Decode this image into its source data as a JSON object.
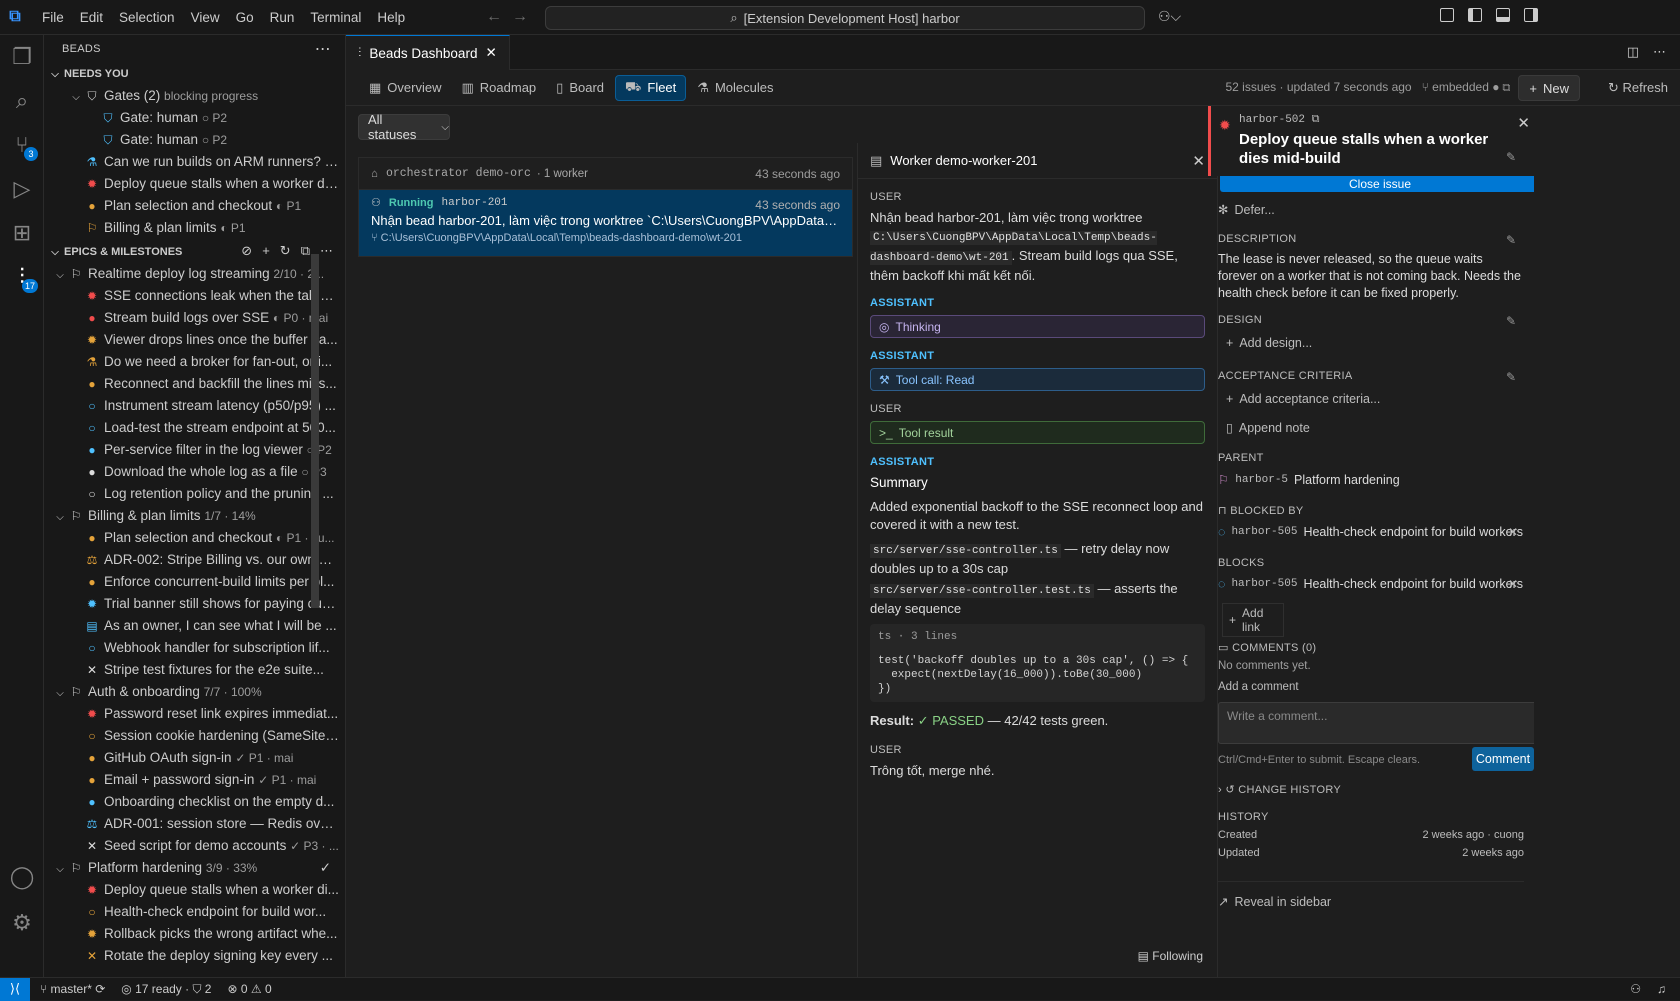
{
  "titlebar": {
    "menu": [
      "File",
      "Edit",
      "Selection",
      "View",
      "Go",
      "Run",
      "Terminal",
      "Help"
    ],
    "command_center": "[Extension Development Host] harbor"
  },
  "activity": {
    "scm_badge": "3",
    "beads_badge": "17"
  },
  "sidebar": {
    "title": "BEADS",
    "needs_you": {
      "label": "NEEDS YOU",
      "items": [
        {
          "text": "Gates (2)",
          "meta": "blocking progress",
          "indent": 1,
          "icon": "⛉",
          "tw": "⌵",
          "color": "#cccccc"
        },
        {
          "text": "Gate: human",
          "meta": "○ P2",
          "indent": 2,
          "icon": "⛉",
          "color": "#4fc1ff"
        },
        {
          "text": "Gate: human",
          "meta": "○ P2",
          "indent": 2,
          "icon": "⛉",
          "color": "#4fc1ff"
        },
        {
          "text": "Can we run builds on ARM runners?",
          "meta": "○...",
          "indent": 1,
          "icon": "⚗",
          "color": "#4fc1ff"
        },
        {
          "text": "Deploy queue stalls when a worker die...",
          "meta": "",
          "indent": 1,
          "icon": "✹",
          "color": "#f14c4c"
        },
        {
          "text": "Plan selection and checkout",
          "meta": "◐ P1",
          "indent": 1,
          "icon": "●",
          "color": "#e5a33a"
        },
        {
          "text": "Billing & plan limits",
          "meta": "◐ P1",
          "indent": 1,
          "icon": "⚐",
          "color": "#e5a33a"
        }
      ]
    },
    "epics": {
      "label": "EPICS & MILESTONES",
      "items": [
        {
          "text": "Realtime deploy log streaming",
          "meta": "2/10 · 2...",
          "indent": 0,
          "icon": "⚐",
          "tw": "⌵",
          "color": "#cccccc"
        },
        {
          "text": "SSE connections leak when the tab cl...",
          "meta": "",
          "indent": 1,
          "icon": "✹",
          "color": "#f14c4c"
        },
        {
          "text": "Stream build logs over SSE",
          "meta": "◐ P0 · mai",
          "indent": 1,
          "icon": "●",
          "color": "#f14c4c"
        },
        {
          "text": "Viewer drops lines once the buffer pa...",
          "meta": "",
          "indent": 1,
          "icon": "✹",
          "color": "#e5a33a"
        },
        {
          "text": "Do we need a broker for fan-out, or i...",
          "meta": "",
          "indent": 1,
          "icon": "⚗",
          "color": "#e5a33a"
        },
        {
          "text": "Reconnect and backfill the lines miss...",
          "meta": "",
          "indent": 1,
          "icon": "●",
          "color": "#e5a33a"
        },
        {
          "text": "Instrument stream latency (p50/p95) ...",
          "meta": "",
          "indent": 1,
          "icon": "○",
          "color": "#4fc1ff"
        },
        {
          "text": "Load-test the stream endpoint at 500...",
          "meta": "",
          "indent": 1,
          "icon": "○",
          "color": "#4fc1ff"
        },
        {
          "text": "Per-service filter in the log viewer",
          "meta": "○ P2",
          "indent": 1,
          "icon": "●",
          "color": "#4fc1ff"
        },
        {
          "text": "Download the whole log as a file",
          "meta": "○ P3",
          "indent": 1,
          "icon": "●",
          "color": "#dcdcdc"
        },
        {
          "text": "Log retention policy and the pruning ...",
          "meta": "",
          "indent": 1,
          "icon": "○",
          "color": "#dcdcdc"
        },
        {
          "text": "Billing & plan limits",
          "meta": "1/7 · 14%",
          "indent": 0,
          "icon": "⚐",
          "tw": "⌵",
          "color": "#cccccc"
        },
        {
          "text": "Plan selection and checkout",
          "meta": "◐ P1 · cu...",
          "indent": 1,
          "icon": "●",
          "color": "#e5a33a"
        },
        {
          "text": "ADR-002: Stripe Billing vs. our own m...",
          "meta": "",
          "indent": 1,
          "icon": "⚖",
          "color": "#e5a33a"
        },
        {
          "text": "Enforce concurrent-build limits per pl...",
          "meta": "",
          "indent": 1,
          "icon": "●",
          "color": "#e5a33a"
        },
        {
          "text": "Trial banner still shows for paying cus...",
          "meta": "",
          "indent": 1,
          "icon": "✹",
          "color": "#4fc1ff"
        },
        {
          "text": "As an owner, I can see what I will be ...",
          "meta": "",
          "indent": 1,
          "icon": "▤",
          "color": "#4fc1ff"
        },
        {
          "text": "Webhook handler for subscription lif...",
          "meta": "",
          "indent": 1,
          "icon": "○",
          "color": "#4fc1ff"
        },
        {
          "text": "Stripe test fixtures for the e2e suite...",
          "meta": "",
          "indent": 1,
          "icon": "✕",
          "color": "#dcdcdc"
        },
        {
          "text": "Auth & onboarding",
          "meta": "7/7 · 100%",
          "indent": 0,
          "icon": "⚐",
          "tw": "⌵",
          "color": "#cccccc"
        },
        {
          "text": "Password reset link expires immediat...",
          "meta": "",
          "indent": 1,
          "icon": "✹",
          "color": "#f14c4c"
        },
        {
          "text": "Session cookie hardening (SameSite, ...",
          "meta": "",
          "indent": 1,
          "icon": "○",
          "color": "#e5a33a"
        },
        {
          "text": "GitHub OAuth sign-in",
          "meta": "✓ P1 · mai",
          "indent": 1,
          "icon": "●",
          "color": "#e5a33a"
        },
        {
          "text": "Email + password sign-in",
          "meta": "✓ P1 · mai",
          "indent": 1,
          "icon": "●",
          "color": "#e5a33a"
        },
        {
          "text": "Onboarding checklist on the empty d...",
          "meta": "",
          "indent": 1,
          "icon": "●",
          "color": "#4fc1ff"
        },
        {
          "text": "ADR-001: session store — Redis over...",
          "meta": "",
          "indent": 1,
          "icon": "⚖",
          "color": "#4fc1ff"
        },
        {
          "text": "Seed script for demo accounts",
          "meta": "✓ P3 · ...",
          "indent": 1,
          "icon": "✕",
          "color": "#dcdcdc"
        },
        {
          "text": "Platform hardening",
          "meta": "3/9 · 33%",
          "indent": 0,
          "icon": "⚐",
          "tw": "⌵",
          "color": "#cccccc",
          "check": "✓"
        },
        {
          "text": "Deploy queue stalls when a worker di...",
          "meta": "",
          "indent": 1,
          "icon": "✹",
          "color": "#f14c4c"
        },
        {
          "text": "Health-check endpoint for build wor...",
          "meta": "",
          "indent": 1,
          "icon": "○",
          "color": "#e5a33a"
        },
        {
          "text": "Rollback picks the wrong artifact whe...",
          "meta": "",
          "indent": 1,
          "icon": "✹",
          "color": "#e5a33a"
        },
        {
          "text": "Rotate the deploy signing key every ...",
          "meta": "",
          "indent": 1,
          "icon": "✕",
          "color": "#e5a33a"
        }
      ]
    }
  },
  "editor": {
    "tab": "Beads Dashboard",
    "views": [
      {
        "label": "Overview",
        "icon": "▦"
      },
      {
        "label": "Roadmap",
        "icon": "▥"
      },
      {
        "label": "Board",
        "icon": "▯"
      },
      {
        "label": "Fleet",
        "icon": "⛟",
        "active": true
      },
      {
        "label": "Molecules",
        "icon": "⚗"
      }
    ],
    "status_text": "52 issues · updated 7 seconds ago",
    "mode": "embedded",
    "new_label": "New",
    "refresh_label": "Refresh",
    "filter": "All statuses",
    "fleet": {
      "orch": "orchestrator demo-orc",
      "orch_meta": "· 1 worker",
      "orch_time": "43 seconds ago",
      "worker_status": "Running",
      "worker_id": "harbor-201",
      "worker_time": "43 seconds ago",
      "worker_text": "Nhận bead harbor-201, làm việc trong worktree `C:\\Users\\CuongBPV\\AppData\\Local\\Temp\\beads-dashboard-demo\\wt-201`",
      "worker_path": "C:\\Users\\CuongBPV\\AppData\\Local\\Temp\\beads-dashboard-demo\\wt-201"
    },
    "worker": {
      "title": "Worker demo-worker-201",
      "user_label": "USER",
      "asst_label": "ASSISTANT",
      "msg1a": "Nhận bead harbor-201, làm việc trong worktree",
      "msg1code": "C:\\Users\\CuongBPV\\AppData\\Local\\Temp\\beads-dashboard-demo\\wt-201",
      "msg1b": ". Stream build logs qua SSE, thêm backoff khi mất kết nối.",
      "thinking": "Thinking",
      "toolcall": "Tool call: Read",
      "toolresult": "Tool result",
      "summary_title": "Summary",
      "summary_text": "Added exponential backoff to the SSE reconnect loop and covered it with a new test.",
      "file1": "src/server/sse-controller.ts",
      "file1_desc": "— retry delay now doubles up to a 30s cap",
      "file2": "src/server/sse-controller.test.ts",
      "file2_desc": "— asserts the delay sequence",
      "code_lang": "ts · 3 lines",
      "code_lines": [
        "test('backoff doubles up to a 30s cap', () => {",
        "  expect(nextDelay(16_000)).toBe(30_000)",
        "})"
      ],
      "result_label": "Result:",
      "result_status": "✓ PASSED",
      "result_text": "— 42/42 tests green.",
      "final_msg": "Trông tốt, merge nhé.",
      "following": "Following"
    },
    "detail": {
      "id": "harbor-502",
      "title": "Deploy queue stalls when a worker dies mid-build",
      "close_issue": "Close issue",
      "defer": "Defer...",
      "description_label": "DESCRIPTION",
      "description": "The lease is never released, so the queue waits forever on a worker that is not coming back. Needs the health check before it can be fixed properly.",
      "design_label": "DESIGN",
      "add_design": "Add design...",
      "acceptance_label": "ACCEPTANCE CRITERIA",
      "add_acceptance": "Add acceptance criteria...",
      "append_note": "Append note",
      "parent_label": "PARENT",
      "parent_id": "harbor-5",
      "parent_title": "Platform hardening",
      "blocked_by_label": "BLOCKED BY",
      "blocked_id": "harbor-505",
      "blocked_title": "Health-check endpoint for build workers",
      "blocks_label": "BLOCKS",
      "blocks_id": "harbor-505",
      "blocks_title": "Health-check endpoint for build workers",
      "add_link": "Add link",
      "comments_label": "COMMENTS (0)",
      "no_comments": "No comments yet.",
      "add_comment": "Add a comment",
      "comment_placeholder": "Write a comment...",
      "comment_hint": "Ctrl/Cmd+Enter to submit. Escape clears.",
      "comment_btn": "Comment",
      "change_history": "CHANGE HISTORY",
      "history_label": "HISTORY",
      "created_label": "Created",
      "created_value": "2 weeks ago · cuong",
      "updated_label": "Updated",
      "updated_value": "2 weeks ago",
      "reveal": "Reveal in sidebar"
    }
  },
  "statusbar": {
    "branch": "master*",
    "ready": "17 ready · ⛉ 2",
    "problems": "⊗ 0 ⚠ 0"
  }
}
